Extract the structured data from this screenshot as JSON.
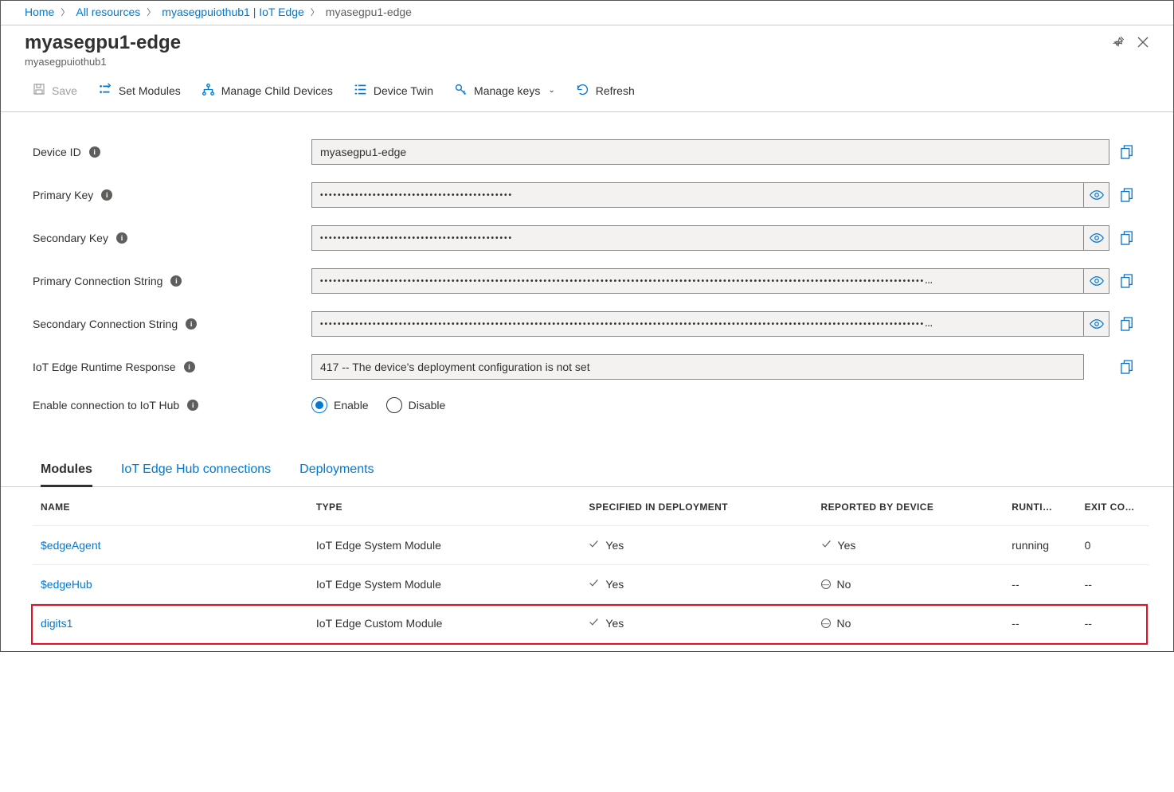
{
  "breadcrumb": {
    "home": "Home",
    "all_resources": "All resources",
    "hub": "myasegpuiothub1 | IoT Edge",
    "current": "myasegpu1-edge"
  },
  "header": {
    "title": "myasegpu1-edge",
    "subtitle": "myasegpuiothub1"
  },
  "toolbar": {
    "save": "Save",
    "set_modules": "Set Modules",
    "manage_child": "Manage Child Devices",
    "device_twin": "Device Twin",
    "manage_keys": "Manage keys",
    "refresh": "Refresh"
  },
  "form": {
    "device_id_label": "Device ID",
    "device_id_value": "myasegpu1-edge",
    "primary_key_label": "Primary Key",
    "primary_key_value": "••••••••••••••••••••••••••••••••••••••••••••",
    "secondary_key_label": "Secondary Key",
    "secondary_key_value": "••••••••••••••••••••••••••••••••••••••••••••",
    "primary_conn_label": "Primary Connection String",
    "primary_conn_value": "••••••••••••••••••••••••••••••••••••••••••••••••••••••••••••••••••••••••••••••••••••••••••••••••••••••••••••••••••••••••••••••••••••••••••…",
    "secondary_conn_label": "Secondary Connection String",
    "secondary_conn_value": "••••••••••••••••••••••••••••••••••••••••••••••••••••••••••••••••••••••••••••••••••••••••••••••••••••••••••••••••••••••••••••••••••••••••••…",
    "runtime_label": "IoT Edge Runtime Response",
    "runtime_value": "417 -- The device's deployment configuration is not set",
    "enable_conn_label": "Enable connection to IoT Hub",
    "enable": "Enable",
    "disable": "Disable"
  },
  "tabs": {
    "modules": "Modules",
    "connections": "IoT Edge Hub connections",
    "deployments": "Deployments"
  },
  "table": {
    "headers": {
      "name": "NAME",
      "type": "TYPE",
      "spec": "SPECIFIED IN DEPLOYMENT",
      "reported": "REPORTED BY DEVICE",
      "runtime": "RUNTI…",
      "exit": "EXIT CO…"
    },
    "rows": [
      {
        "name": "$edgeAgent",
        "type": "IoT Edge System Module",
        "spec": "Yes",
        "spec_ok": true,
        "reported": "Yes",
        "reported_ok": true,
        "runtime": "running",
        "exit": "0"
      },
      {
        "name": "$edgeHub",
        "type": "IoT Edge System Module",
        "spec": "Yes",
        "spec_ok": true,
        "reported": "No",
        "reported_ok": false,
        "runtime": "--",
        "exit": "--"
      },
      {
        "name": "digits1",
        "type": "IoT Edge Custom Module",
        "spec": "Yes",
        "spec_ok": true,
        "reported": "No",
        "reported_ok": false,
        "runtime": "--",
        "exit": "--"
      }
    ]
  }
}
